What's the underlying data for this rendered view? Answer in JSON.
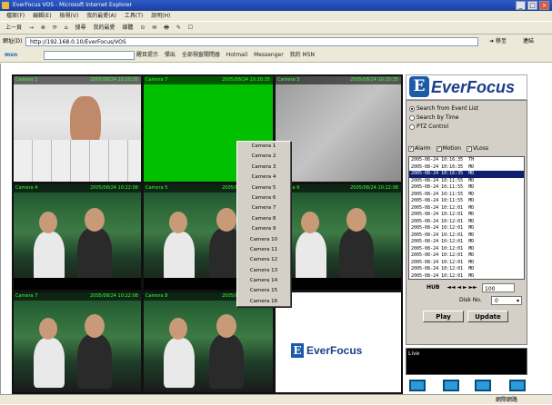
{
  "window": {
    "title": "EverFocus VOS - Microsoft Internet Explorer",
    "menu": [
      "檔案(F)",
      "編輯(E)",
      "檢視(V)",
      "我的最愛(A)",
      "工具(T)",
      "說明(H)"
    ],
    "toolbar": [
      "上一頁",
      "→",
      "⊗",
      "⟳",
      "⌂",
      "搜尋",
      "我的最愛",
      "媒體",
      "⊙",
      "✉",
      "🖶",
      "✎",
      "☐"
    ],
    "address_label": "網址(D)",
    "address_value": "http://192.168.0.10/EverFocus/VOS",
    "go_label": "移至",
    "links_label": "連結",
    "links": [
      "搜尋",
      "醒目提示",
      "彈出",
      "全部視窗關閉器",
      "Hotmail",
      "Messenger",
      "我的 MSN"
    ]
  },
  "cameras": [
    {
      "label": "Camera 1",
      "timestamp": "2005/08/24 10:20:35"
    },
    {
      "label": "Camera 7",
      "timestamp": "2005/08/24 10:20:35"
    },
    {
      "label": "Camera 3",
      "timestamp": "2005/08/24 10:20:35"
    },
    {
      "label": "Camera 4",
      "timestamp": "2005/08/24 10:22:08"
    },
    {
      "label": "Camera 5",
      "timestamp": "2005/08/24 10:22:08"
    },
    {
      "label": "Camera 6",
      "timestamp": "2005/08/24 10:22:08"
    },
    {
      "label": "Camera 7",
      "timestamp": "2005/08/24 10:22:08"
    },
    {
      "label": "Camera 8",
      "timestamp": "2005/08/24 10:22:08"
    }
  ],
  "camera_menu": [
    "Camera 1",
    "Camera 2",
    "Camera 3",
    "Camera 4",
    "Camera 5",
    "Camera 6",
    "Camera 7",
    "Camera 8",
    "Camera 9",
    "Camera 10",
    "Camera 11",
    "Camera 12",
    "Camera 13",
    "Camera 14",
    "Camera 15",
    "Camera 16"
  ],
  "brand": {
    "letter": "E",
    "name": "EverFocus",
    "watermark": "EverFocus",
    "color": "#1d5aa8"
  },
  "search": {
    "options": [
      "Search from Event List",
      "Search by Time",
      "PTZ Control"
    ],
    "selected": 0,
    "filters": [
      {
        "label": "Alarm",
        "checked": true
      },
      {
        "label": "Motion",
        "checked": true
      },
      {
        "label": "VLoss",
        "checked": true
      }
    ]
  },
  "events": [
    {
      "time": "2005-08-24 10:16:35",
      "type": "TH"
    },
    {
      "time": "2005-08-24 10:16:35",
      "type": "MD"
    },
    {
      "time": "2005-08-24 10:16:35",
      "type": "MD"
    },
    {
      "time": "2005-08-24 10:11:55",
      "type": "MD"
    },
    {
      "time": "2005-08-24 10:11:55",
      "type": "MD"
    },
    {
      "time": "2005-08-24 10:11:55",
      "type": "MD"
    },
    {
      "time": "2005-08-24 10:11:55",
      "type": "MD"
    },
    {
      "time": "2005-08-24 10:12:01",
      "type": "MD"
    },
    {
      "time": "2005-08-24 10:12:01",
      "type": "MD"
    },
    {
      "time": "2005-08-24 10:12:01",
      "type": "MD"
    },
    {
      "time": "2005-08-24 10:12:01",
      "type": "MD"
    },
    {
      "time": "2005-08-24 10:12:01",
      "type": "MD"
    },
    {
      "time": "2005-08-24 10:12:01",
      "type": "MD"
    },
    {
      "time": "2005-08-24 10:12:01",
      "type": "MD"
    },
    {
      "time": "2005-08-24 10:12:01",
      "type": "MD"
    },
    {
      "time": "2005-08-24 10:12:01",
      "type": "MD"
    },
    {
      "time": "2005-08-24 10:12:01",
      "type": "MD"
    },
    {
      "time": "2005-08-24 10:12:01",
      "type": "MD"
    }
  ],
  "selected_event": 2,
  "nav": {
    "label": "HUB",
    "symbols": "◄◄ ◄ ► ►►",
    "zoom_value": "100"
  },
  "disk": {
    "label": "Disk No.",
    "value": "0"
  },
  "buttons": {
    "play": "Play",
    "update": "Update"
  },
  "live_label": "Live",
  "status": {
    "left": "",
    "right": "網際網路"
  }
}
